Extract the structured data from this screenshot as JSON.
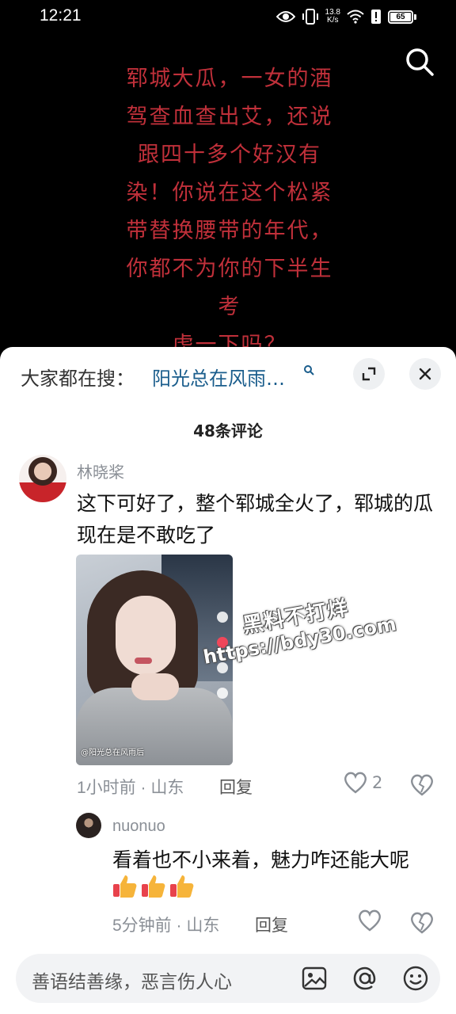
{
  "status_bar": {
    "time": "12:21",
    "net_speed_value": "13.8",
    "net_speed_unit": "K/s",
    "battery": "65",
    "icons": [
      "eye-icon",
      "vibrate-icon",
      "wifi-icon",
      "alert-icon",
      "battery-icon"
    ]
  },
  "video": {
    "overlay_text": "郓城大瓜，一女的酒\n驾查血查出艾，还说\n跟四十多个好汉有\n染！你说在这个松紧\n带替换腰带的年代，\n你都不为你的下半生考\n虑一下吗？",
    "search_icon": "search-icon"
  },
  "sheet": {
    "hot_search_label": "大家都在搜：",
    "hot_search_link": "阳光总在风雨…",
    "comment_count": "48条评论",
    "comments": [
      {
        "username": "林晓桨",
        "text": "这下可好了，整个郓城全火了，郓城的瓜现在是不敢吃了",
        "image_caption": "@阳光总在风雨后",
        "time": "1小时前 · 山东",
        "reply_label": "回复",
        "likes": "2"
      },
      {
        "username": "nuonuo",
        "text": "看着也不小来着，魅力咋还能大呢",
        "emoji": [
          "thumbs-up-icon",
          "thumbs-up-icon",
          "thumbs-up-icon"
        ],
        "time": "5分钟前 · 山东",
        "reply_label": "回复"
      }
    ],
    "watermark_line1": "黑料不打烊",
    "watermark_line2": "https://bdy30.com",
    "input_placeholder": "善语结善缘，恶言伤人心"
  },
  "colors": {
    "overlay_text": "#c0303a",
    "link": "#1a5d8c",
    "meta": "#8a8f96"
  }
}
